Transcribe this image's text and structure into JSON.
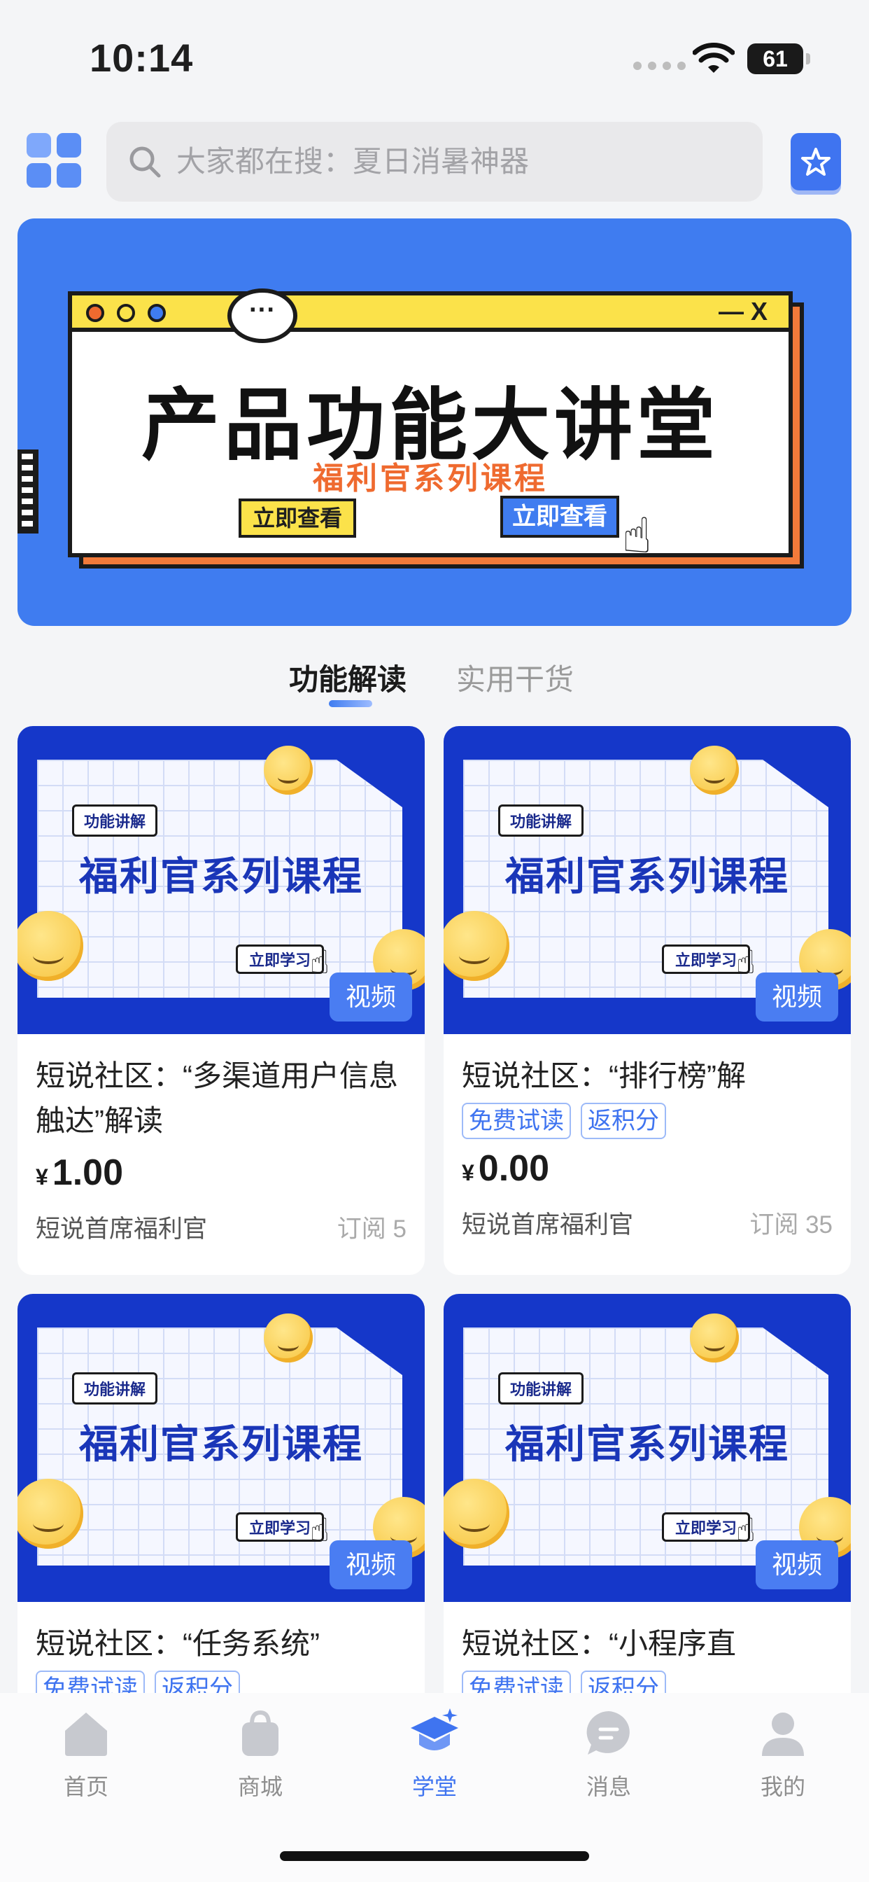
{
  "status_bar": {
    "time": "10:14",
    "battery": "61"
  },
  "header": {
    "search_placeholder": "大家都在搜：夏日消暑神器",
    "grid_icon": "grid-apps-icon",
    "star_icon": "star-icon"
  },
  "banner": {
    "title": "产品功能大讲堂",
    "subtitle": "福利官系列课程",
    "button_left": "立即查看",
    "button_right": "立即查看",
    "window_controls": "— X",
    "bubble": "···"
  },
  "tabs": [
    {
      "label": "功能解读",
      "active": true
    },
    {
      "label": "实用干货",
      "active": false
    }
  ],
  "cards": [
    {
      "thumb_tag": "功能讲解",
      "thumb_title": "福利官系列课程",
      "thumb_button": "立即学习",
      "media_badge": "视频",
      "title": "短说社区：“多渠道用户信息触达”解读",
      "price_currency": "¥",
      "price": "1.00",
      "author": "短说首席福利官",
      "subscribers": "订阅 5"
    },
    {
      "thumb_tag": "功能讲解",
      "thumb_title": "福利官系列课程",
      "thumb_button": "立即学习",
      "media_badge": "视频",
      "title": "短说社区：“排行榜”解",
      "tags": [
        "免费试读",
        "返积分"
      ],
      "price_currency": "¥",
      "price": "0.00",
      "author": "短说首席福利官",
      "subscribers": "订阅 35"
    },
    {
      "thumb_tag": "功能讲解",
      "thumb_title": "福利官系列课程",
      "thumb_button": "立即学习",
      "media_badge": "视频",
      "title": "短说社区：“任务系统”",
      "tags": [
        "免费试读",
        "返积分"
      ]
    },
    {
      "thumb_tag": "功能讲解",
      "thumb_title": "福利官系列课程",
      "thumb_button": "立即学习",
      "media_badge": "视频",
      "title": "短说社区：“小程序直",
      "tags": [
        "免费试读",
        "返积分"
      ]
    }
  ],
  "bottom_nav": [
    {
      "label": "首页",
      "icon": "home-icon",
      "active": false
    },
    {
      "label": "商城",
      "icon": "shopping-bag-icon",
      "active": false
    },
    {
      "label": "学堂",
      "icon": "graduation-cap-icon",
      "active": true
    },
    {
      "label": "消息",
      "icon": "chat-bubble-icon",
      "active": false
    },
    {
      "label": "我的",
      "icon": "user-icon",
      "active": false
    }
  ],
  "colors": {
    "accent": "#3f74f0",
    "banner_bg": "#3f7cf0",
    "thumb_bg": "#1537c9",
    "orange": "#ef6a2f",
    "yellow": "#fbe24a"
  }
}
